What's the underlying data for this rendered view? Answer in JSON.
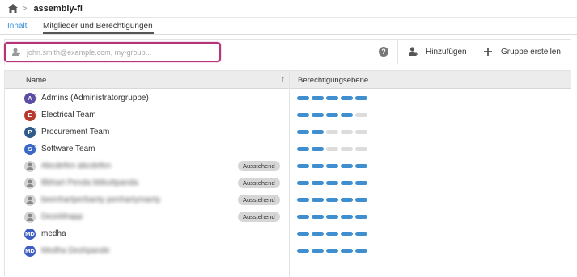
{
  "breadcrumb": {
    "title": "assembly-fl",
    "separator": ">"
  },
  "tabs": [
    {
      "label": "Inhalt",
      "active": false
    },
    {
      "label": "Mitglieder und Berechtigungen",
      "active": true
    }
  ],
  "search": {
    "placeholder": "john.smith@example.com, my-group...",
    "value": ""
  },
  "toolbar": {
    "add_label": "Hinzufügen",
    "create_group_label": "Gruppe erstellen",
    "help": "?"
  },
  "table": {
    "columns": {
      "name": "Name",
      "permission": "Berechtigungsebene"
    },
    "rows": [
      {
        "avatar": "A",
        "avatar_color": "#5c4ca3",
        "name": "Admins (Administratorgruppe)",
        "blurred": false,
        "badge": "",
        "level": 5
      },
      {
        "avatar": "E",
        "avatar_color": "#b83a2e",
        "name": "Electrical Team",
        "blurred": false,
        "badge": "",
        "level": 4
      },
      {
        "avatar": "P",
        "avatar_color": "#2e5a8c",
        "name": "Procurement Team",
        "blurred": false,
        "badge": "",
        "level": 2
      },
      {
        "avatar": "S",
        "avatar_color": "#3a68c4",
        "name": "Software Team",
        "blurred": false,
        "badge": "",
        "level": 2
      },
      {
        "avatar": "",
        "avatar_color": "#d4d4d4",
        "name": "Abcdefen abcdefen",
        "blurred": true,
        "badge": "Ausstehend",
        "level": 5
      },
      {
        "avatar": "",
        "avatar_color": "#d4d4d4",
        "name": "Bbhart Penda bbbuttpanda",
        "blurred": true,
        "badge": "Ausstehend",
        "level": 5
      },
      {
        "avatar": "",
        "avatar_color": "#d4d4d4",
        "name": "beenhartperbanty penhartymanty",
        "blurred": true,
        "badge": "Ausstehend",
        "level": 5
      },
      {
        "avatar": "",
        "avatar_color": "#d4d4d4",
        "name": "Dezebhapp",
        "blurred": true,
        "badge": "Ausstehend",
        "level": 5
      },
      {
        "avatar": "MD",
        "avatar_color": "#3f5cc4",
        "name": "medha",
        "blurred": false,
        "badge": "",
        "level": 5
      },
      {
        "avatar": "MD",
        "avatar_color": "#3f5cc4",
        "name": "Medha Deshpande",
        "blurred": true,
        "badge": "",
        "level": 5
      }
    ]
  },
  "colors": {
    "accent": "#3b8fd6",
    "focus": "#b5347a",
    "bar_on": "#3e8ed0",
    "bar_off": "#dcdcdc"
  }
}
